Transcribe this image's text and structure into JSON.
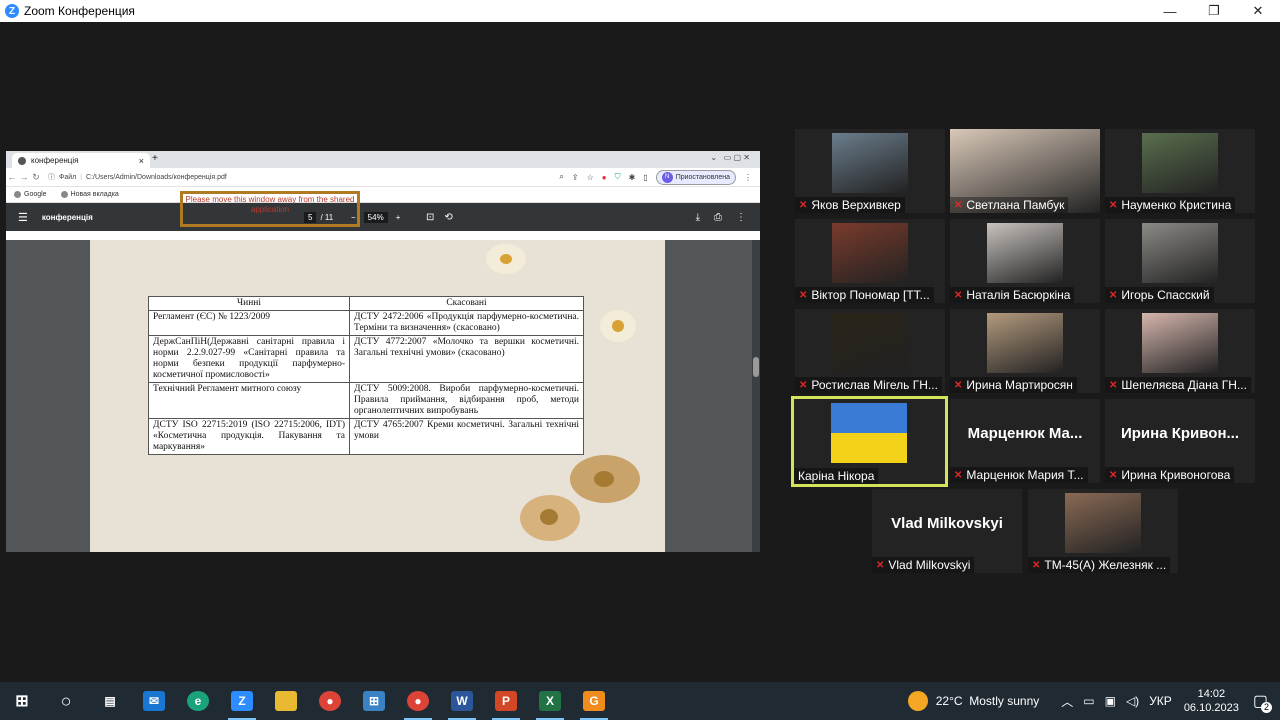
{
  "window": {
    "title": "Zoom Конференция",
    "minimize": "—",
    "maximize": "❐",
    "close": "✕"
  },
  "browser": {
    "tab_title": "конференція",
    "tab_close": "×",
    "new_tab": "+",
    "url_prefix": "Файл",
    "url": "C:/Users/Admin/Downloads/конференція.pdf",
    "profile_initial": "N",
    "profile_status": "Приостановлена",
    "bookmarks": [
      "Google",
      "Новая вкладка"
    ]
  },
  "pdf": {
    "title": "конференція",
    "page_current": "5",
    "page_total": "/ 11",
    "zoom": "54%",
    "zoom_out": "−",
    "zoom_in": "+",
    "share_warning": "Please move this window away from the shared application",
    "table": {
      "headers": [
        "Чинні",
        "Скасовані"
      ],
      "rows": [
        [
          "Регламент (ЄС) № 1223/2009",
          "ДСТУ 2472:2006 «Продукція парфумерно-косметична. Терміни та визначення» (скасовано)"
        ],
        [
          "ДержСанПіН(Державні санітарні правила і норми 2.2.9.027-99 «Санітарні правила та норми безпеки продукції парфумерно-косметичної промисловості»",
          "ДСТУ 4772:2007 «Молочко та вершки косметичні. Загальні технічні умови» (скасовано)"
        ],
        [
          "Технічний Регламент митного союзу",
          "ДСТУ 5009:2008. Вироби парфумерно-косметичні. Правила приймання, відбирання проб, методи органолептичних випробувань"
        ],
        [
          "ДСТУ ISO 22715:2019 (ISO 22715:2006, IDT) «Косметична продукція. Пакування та маркування»",
          "ДСТУ 4765:2007 Креми косметичні. Загальні технічні умови"
        ]
      ]
    }
  },
  "participants": [
    {
      "name": "Яков Верхивкер",
      "bg": "#6b7d8c"
    },
    {
      "name": "Светлана Памбук",
      "bg": "#d9c8b8"
    },
    {
      "name": "Науменко Кристина",
      "bg": "#5a6f4e"
    },
    {
      "name": "Віктор Пономар [ТТ...",
      "bg": "#7a3b2c"
    },
    {
      "name": "Наталія Басюркіна",
      "bg": "#c9c3bf"
    },
    {
      "name": "Игорь Спасский",
      "bg": "#8c8a86"
    },
    {
      "name": "Ростислав Мігель ГН...",
      "bg": "#2a2418"
    },
    {
      "name": "Ирина Мартиросян",
      "bg": "#b49a7e"
    },
    {
      "name": "Шепеляєва Діана ГН...",
      "bg": "#d6b6ad"
    },
    {
      "name": "Каріна Нікора",
      "bg": "#3a7bd5"
    },
    {
      "name": "Марценюк Мария Т...",
      "big": "Марценюк  Ма..."
    },
    {
      "name": "Ирина Кривоногова",
      "big": "Ирина  Кривон..."
    },
    {
      "name": "Vlad Milkovskyi",
      "big": "Vlad Milkovskyi"
    },
    {
      "name": "ТМ-45(А) Железняк ...",
      "bg": "#8a6a55"
    }
  ],
  "tray": {
    "weather": "22°C  Mostly sunny",
    "lang": "УКР",
    "time": "14:02",
    "date": "06.10.2023",
    "notifications": "2"
  }
}
